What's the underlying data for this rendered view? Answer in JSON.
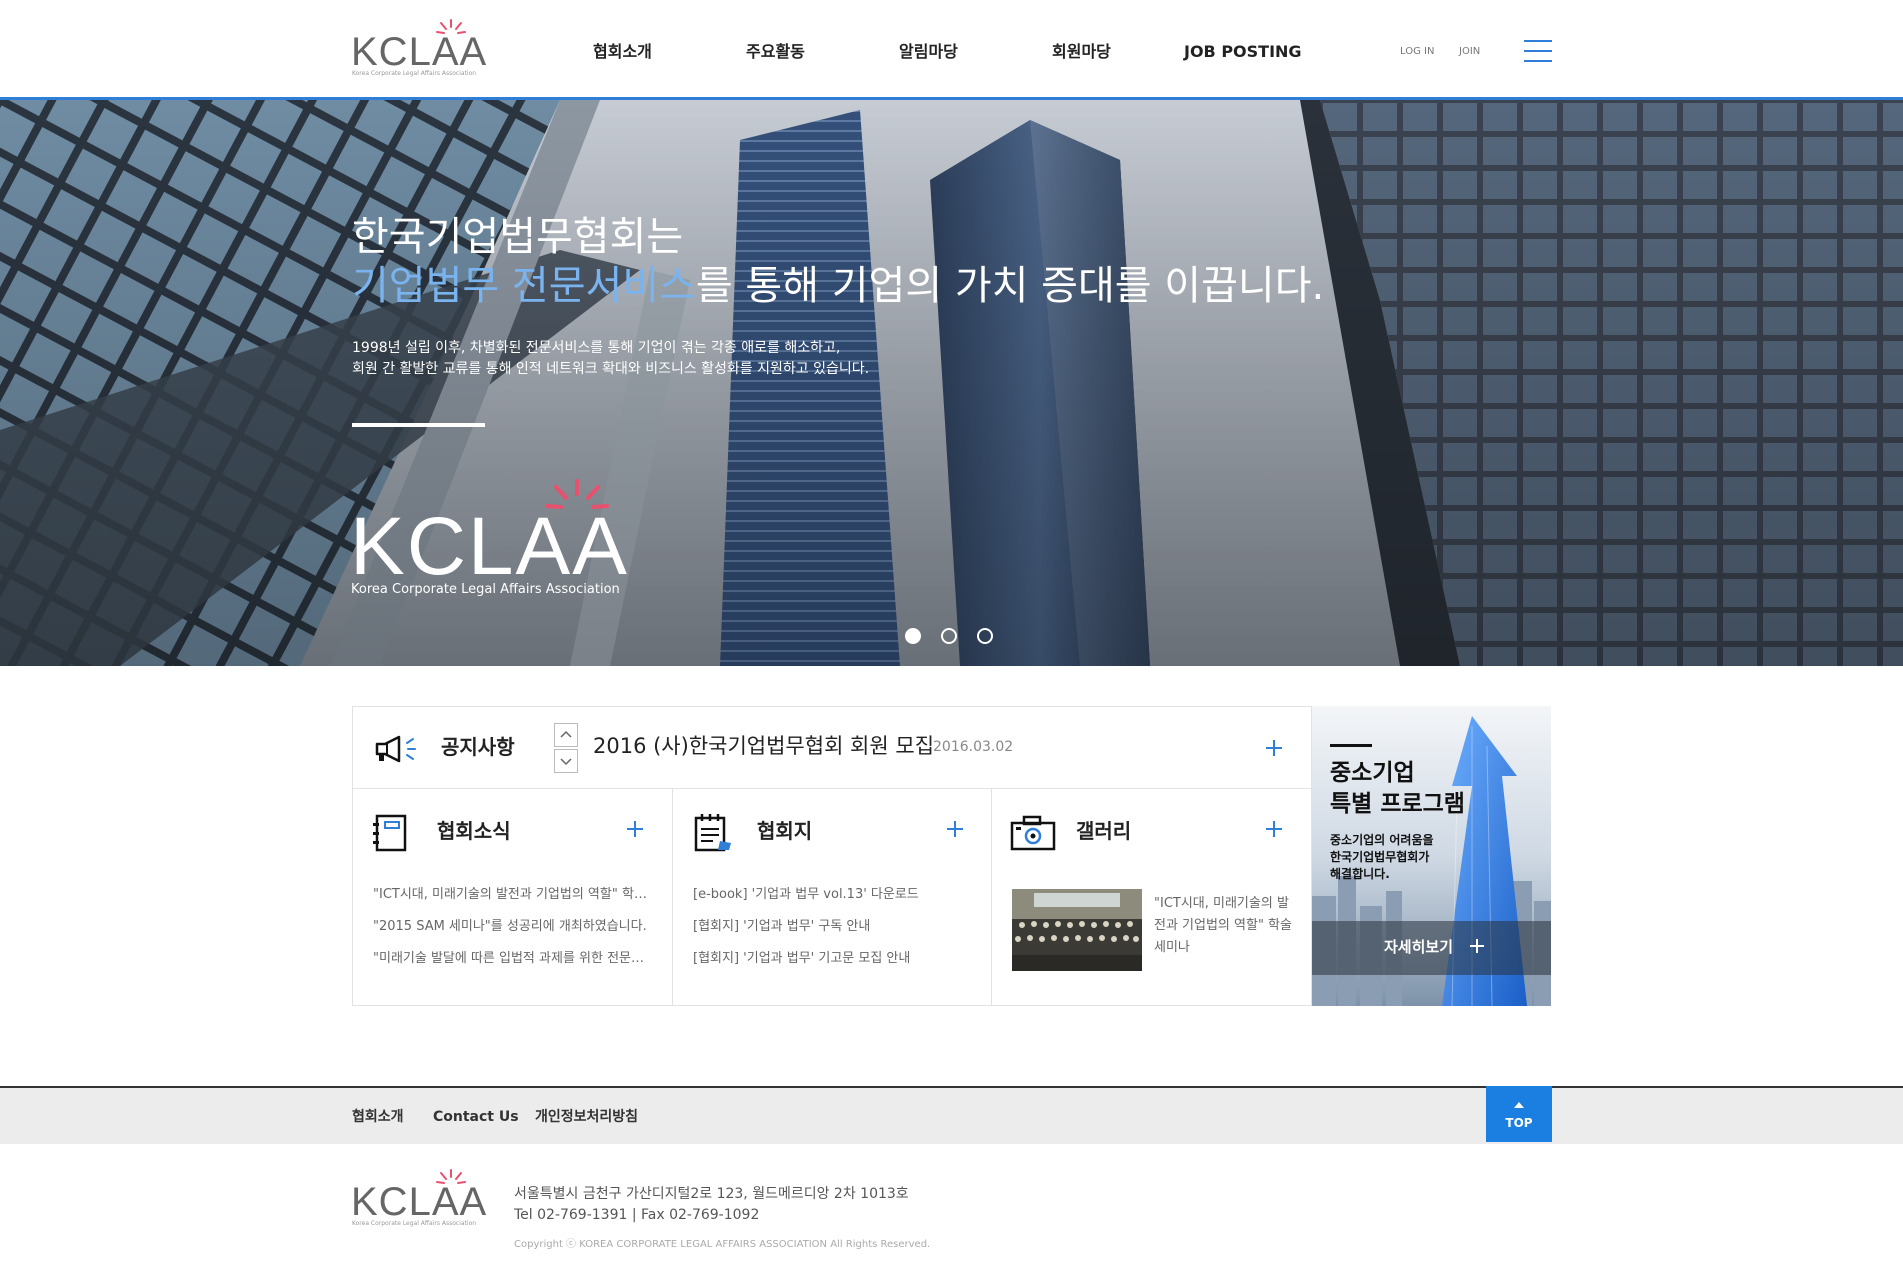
{
  "brand": {
    "logo_text": "KCLAA",
    "logo_sub": "Korea Corporate Legal Affairs Association",
    "accent": "#2f7fd8",
    "burst_color": "#e8506e"
  },
  "header": {
    "nav": [
      "협회소개",
      "주요활동",
      "알림마당",
      "회원마당",
      "JOB POSTING"
    ],
    "login_label": "LOG IN",
    "join_label": "JOIN",
    "menu_icon": "hamburger-icon"
  },
  "hero": {
    "title_line1": "한국기업법무협회는",
    "title_highlight": "기업법무 전문서비스",
    "title_line2_rest": "를 통해 기업의 가치 증대를 이끕니다.",
    "desc_line1": "1998년 설립 이후, 차별화된 전문서비스를 통해 기업이 겪는 각종 애로를 해소하고,",
    "desc_line2": "회원 간 활발한 교류를 통해 인적 네트워크 확대와 비즈니스 활성화를 지원하고 있습니다.",
    "logo_text": "KCLAA",
    "logo_sub": "Korea Corporate Legal Affairs Association",
    "slides_total": 3,
    "slide_active": 1
  },
  "notice": {
    "label": "공지사항",
    "icon": "megaphone-icon",
    "title": "2016 (사)한국기업법무협회 회원 모집",
    "date": "2016.03.02"
  },
  "columns": {
    "news": {
      "title": "협회소식",
      "icon": "notebook-icon",
      "items": [
        "\"ICT시대, 미래기술의 발전과 기업법의 역할\" 학술 세미나",
        "\"2015 SAM 세미나\"를 성공리에 개최하였습니다.",
        "\"미래기술 발달에 따른 입법적 과제를 위한 전문가 토론회\""
      ]
    },
    "journal": {
      "title": "협회지",
      "icon": "document-icon",
      "items": [
        "[e-book] '기업과 법무 vol.13' 다운로드",
        "[협회지] '기업과 법무' 구독 안내",
        "[협회지] '기업과 법무' 기고문 모집 안내"
      ]
    },
    "gallery": {
      "title": "갤러리",
      "icon": "camera-icon",
      "caption": "\"ICT시대, 미래기술의 발전과 기업법의 역할\" 학술 세미나"
    }
  },
  "promo": {
    "title_line1": "중소기업",
    "title_line2": "특별 프로그램",
    "desc_line1": "중소기업의 어려움을",
    "desc_line2": "한국기업법무협회가",
    "desc_line3": "해결합니다.",
    "button_label": "자세히보기"
  },
  "footer": {
    "nav": [
      "협회소개",
      "Contact Us",
      "개인정보처리방침"
    ],
    "top_label": "TOP",
    "address": "서울특별시 금천구 가산디지털2로 123, 월드메르디앙 2차 1013호",
    "contact": "Tel 02-769-1391 | Fax 02-769-1092",
    "copyright": "Copyright ⓒ KOREA CORPORATE LEGAL AFFAIRS ASSOCIATION All Rights Reserved."
  }
}
